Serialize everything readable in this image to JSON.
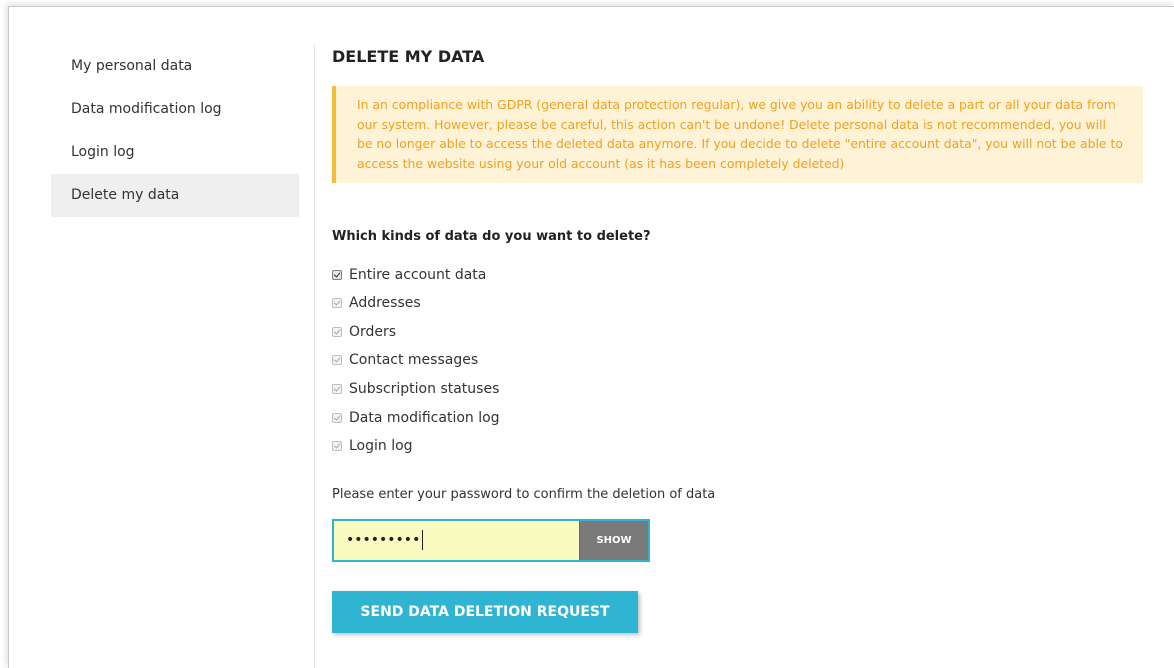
{
  "sidebar": {
    "items": [
      {
        "label": "My personal data",
        "active": false
      },
      {
        "label": "Data modification log",
        "active": false
      },
      {
        "label": "Login log",
        "active": false
      },
      {
        "label": "Delete my data",
        "active": true
      }
    ]
  },
  "main": {
    "title": "DELETE MY DATA",
    "warning_text": "In an compliance with GDPR (general data protection regular), we give you an ability to delete a part or all your data from our system. However, please be careful, this action can't be undone! Delete personal data is not recommended, you will be no longer able to access the deleted data anymore. If you decide to delete \"entire account data\", you will not be able to access the website using your old account (as it has been completely deleted)",
    "question": "Which kinds of data do you want to delete?",
    "options": [
      {
        "label": "Entire account data",
        "checked": true,
        "enabled": true
      },
      {
        "label": "Addresses",
        "checked": true,
        "enabled": false
      },
      {
        "label": "Orders",
        "checked": true,
        "enabled": false
      },
      {
        "label": "Contact messages",
        "checked": true,
        "enabled": false
      },
      {
        "label": "Subscription statuses",
        "checked": true,
        "enabled": false
      },
      {
        "label": "Data modification log",
        "checked": true,
        "enabled": false
      },
      {
        "label": "Login log",
        "checked": true,
        "enabled": false
      }
    ],
    "password_prompt": "Please enter your password to confirm the deletion of data",
    "password_masked": "•••••••••",
    "show_label": "SHOW",
    "submit_label": "SEND DATA DELETION REQUEST"
  },
  "colors": {
    "accent": "#2fb5d2",
    "warning_bg": "#fff3d7",
    "warning_border": "#f5bc3c",
    "warning_text": "#f0a020",
    "password_bg": "#fafbc0",
    "show_button": "#7a7a7a"
  }
}
